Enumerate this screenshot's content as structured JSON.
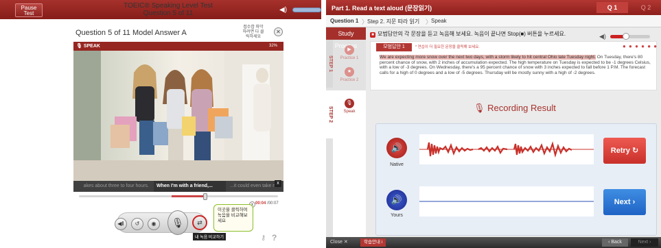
{
  "left": {
    "pause_label": "Pause\nTest",
    "app_title": "TOEIC® Speaking Level Test",
    "question_counter": "Question 5 of 11",
    "heading": "Question 5 of 11 Model Answer A",
    "hint_text": "접수합 파악하려면 다 클릭하세요",
    "speak_label": "SPEAK",
    "speak_percent": "32%",
    "captions": [
      "akes about three to four hours.",
      "When I'm with a friend,...",
      "...it could even take mo"
    ],
    "time_current": "00:04",
    "time_total": "/00:07",
    "callout_text": "이곳을 클릭하여 녹음을 비교해보세요",
    "compare_tooltip": "내 녹음 비교하기",
    "help_icons": [
      "key-icon",
      "question-icon"
    ]
  },
  "right": {
    "part_title": "Part 1. Read a text aloud (문장읽기)",
    "q_tabs": [
      "Q 1",
      "Q 2"
    ],
    "crumbs": [
      "Question 1",
      "Step 2. 지문 따라 읽기",
      "Speak"
    ],
    "study_process": "Study Process",
    "step1": "STEP 1",
    "step2": "STEP 2",
    "side_items": [
      "Practice 1",
      "Practice 2",
      "Speak"
    ],
    "instruction": "모범답안의 각 문장을 듣고 녹음해 보세요. 녹음이 끝나면 Stop(■) 버튼을 누르세요.",
    "model_tab": "모범답안 1",
    "model_hint": "* 연습이 더 필요한 문장을 클릭해 보세요.",
    "passage_highlight": "We are expecting more snow over the next two days, with a storm likely to hit central Ohio late Tuesday night.",
    "passage_rest": " On Tuesday, there's 80 percent chance of snow, with 2 inches of accumulation expected. The high temperature on Tuesday is expected to be -1 degrees Celsius, with a low of -3 degrees. On Wednesday, there's a 95 percent chance of snow with 3 inches expected to fall before 1 P.M. The forecast calls for a high of 0 degrees and a low of -5 degrees. Thursday will be mostly sunny with a high of -2 degrees.",
    "recording_result": "Recording Result",
    "native_label": "Native",
    "yours_label": "Yours",
    "retry_label": "Retry",
    "next_label": "Next",
    "close_label": "Close",
    "learn_guide": "학습안내",
    "back_label": "Back",
    "next_small_label": "Next"
  },
  "colors": {
    "brand_red": "#a5302b",
    "retry_red": "#e0463f",
    "next_blue": "#2f7ad6",
    "wave_red": "#c8302a",
    "wave_blue": "#2a4fb5"
  }
}
